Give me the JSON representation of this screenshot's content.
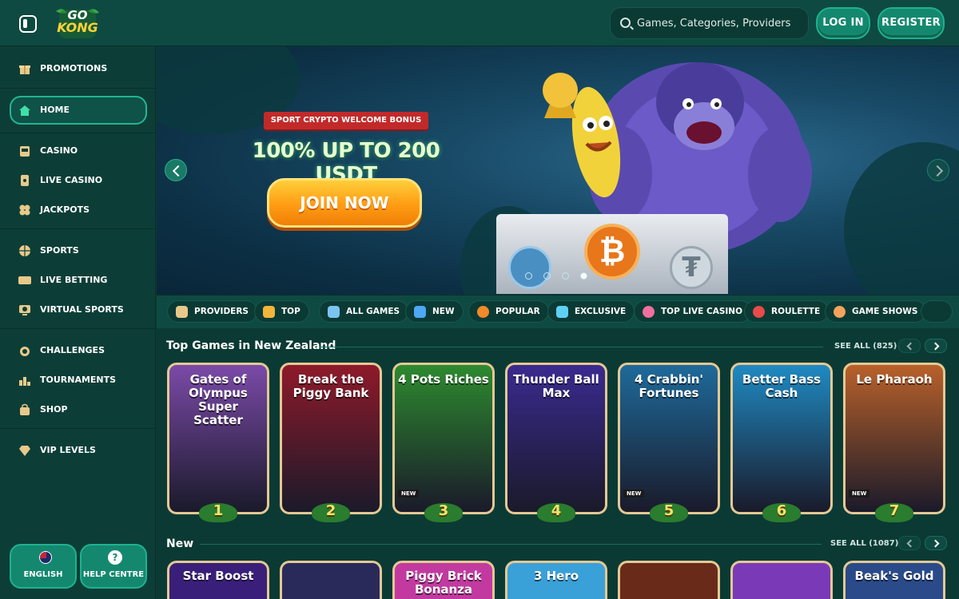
{
  "header": {
    "logo_line1": "GO",
    "logo_line2": "KONG",
    "search_placeholder": "Games, Categories, Providers",
    "login_label": "LOG IN",
    "register_label": "REGISTER"
  },
  "sidebar": {
    "items": [
      {
        "label": "PROMOTIONS",
        "icon": "gift-icon"
      },
      {
        "label": "HOME",
        "icon": "home-icon",
        "active": true
      },
      {
        "label": "CASINO",
        "icon": "slot-machine-icon"
      },
      {
        "label": "LIVE CASINO",
        "icon": "playing-card-icon"
      },
      {
        "label": "JACKPOTS",
        "icon": "clover-icon"
      },
      {
        "label": "SPORTS",
        "icon": "basketball-icon"
      },
      {
        "label": "LIVE BETTING",
        "icon": "live-icon"
      },
      {
        "label": "VIRTUAL SPORTS",
        "icon": "virtual-sports-icon"
      },
      {
        "label": "CHALLENGES",
        "icon": "medal-icon"
      },
      {
        "label": "TOURNAMENTS",
        "icon": "podium-icon"
      },
      {
        "label": "SHOP",
        "icon": "shopping-bag-icon"
      },
      {
        "label": "VIP LEVELS",
        "icon": "diamond-icon"
      }
    ],
    "language_label": "ENGLISH",
    "help_label": "HELP CENTRE",
    "help_glyph": "?"
  },
  "hero": {
    "ribbon": "SPORT CRYPTO WELCOME BONUS",
    "title": "100% UP TO 200 USDT",
    "cta": "JOIN NOW",
    "coin_btc": "₿",
    "coin_usdt": "₮",
    "slides_count": 4,
    "active_slide": 4
  },
  "categories": [
    {
      "label": "PROVIDERS",
      "color": "#e8c98a"
    },
    {
      "label": "TOP",
      "color": "#f2b53a"
    },
    {
      "label": "ALL GAMES",
      "color": "#7ac4f0"
    },
    {
      "label": "NEW",
      "color": "#4da8f5"
    },
    {
      "label": "POPULAR",
      "color": "#f28a2a"
    },
    {
      "label": "EXCLUSIVE",
      "color": "#5fd0f5"
    },
    {
      "label": "TOP LIVE CASINO",
      "color": "#f06fa0"
    },
    {
      "label": "ROULETTE",
      "color": "#e94a4a"
    },
    {
      "label": "GAME SHOWS",
      "color": "#f5a35c"
    }
  ],
  "top_games": {
    "title": "Top Games in New Zealand",
    "see_all": "SEE ALL (825)",
    "games": [
      {
        "name": "Gates of Olympus Super Scatter",
        "rank": "1",
        "bg": "#7b4aa8",
        "new": false
      },
      {
        "name": "Break the Piggy Bank",
        "rank": "2",
        "bg": "#8e1a2a",
        "new": false
      },
      {
        "name": "4 Pots Riches",
        "rank": "3",
        "bg": "#2d8a2f",
        "new": true
      },
      {
        "name": "Thunder Ball Max",
        "rank": "4",
        "bg": "#3a2a8f",
        "new": false
      },
      {
        "name": "4 Crabbin' Fortunes",
        "rank": "5",
        "bg": "#1e6a9a",
        "new": true
      },
      {
        "name": "Better Bass Cash",
        "rank": "6",
        "bg": "#1f8ac2",
        "new": false
      },
      {
        "name": "Le Pharaoh",
        "rank": "7",
        "bg": "#b8612a",
        "new": true
      }
    ],
    "new_badge": "NEW"
  },
  "new_games": {
    "title": "New",
    "see_all": "SEE ALL (1087)",
    "games": [
      {
        "name": "Star Boost",
        "bg": "#3a1f7a"
      },
      {
        "name": "",
        "bg": "#2a2a5a"
      },
      {
        "name": "Piggy Brick Bonanza",
        "bg": "#c23aa0"
      },
      {
        "name": "3 Hero",
        "bg": "#3aa0d8"
      },
      {
        "name": "",
        "bg": "#6a2a1a"
      },
      {
        "name": "",
        "bg": "#7a3ab8"
      },
      {
        "name": "Beak's Gold",
        "bg": "#2a4a8a"
      }
    ]
  }
}
